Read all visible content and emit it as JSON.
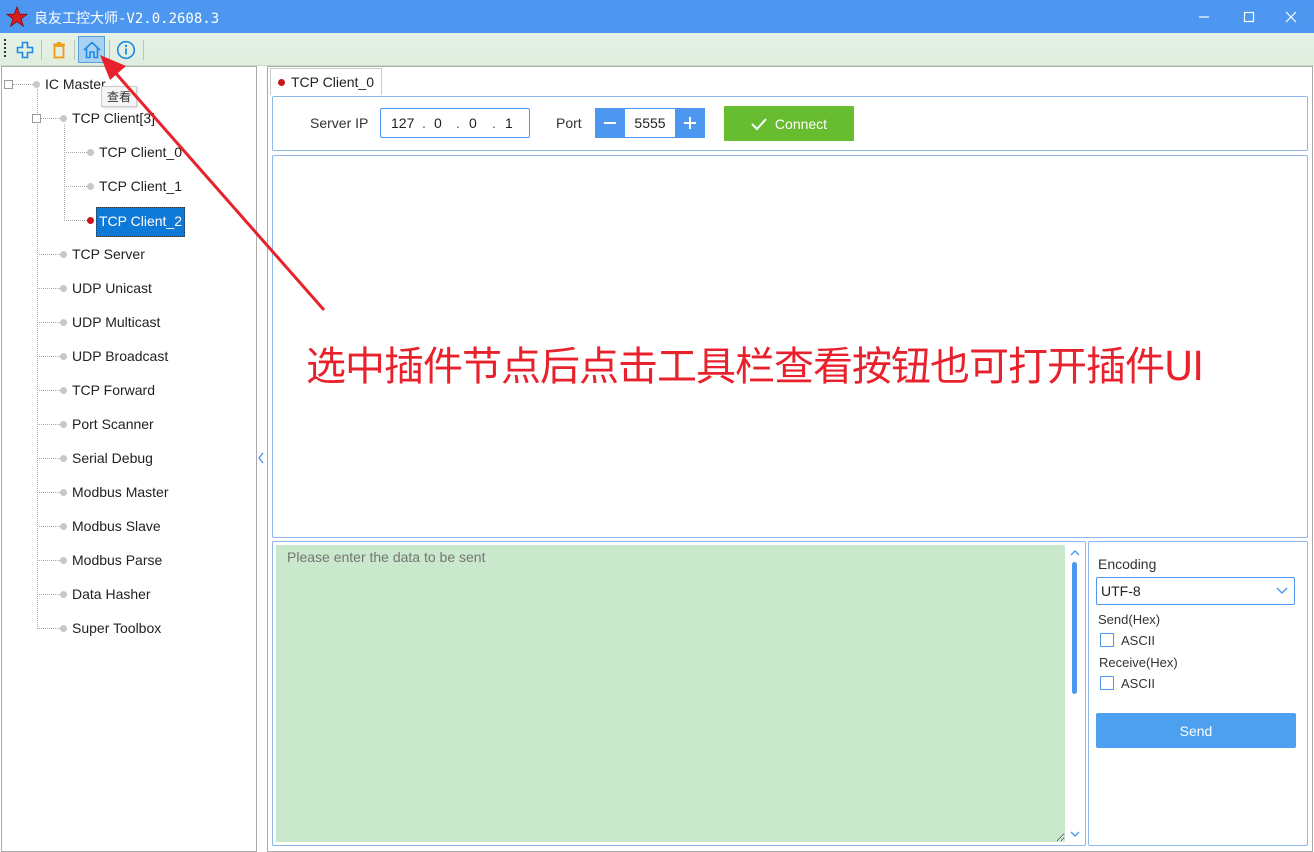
{
  "window": {
    "title": "良友工控大师-V2.0.2608.3",
    "brand_color": "#4d97f0"
  },
  "toolbar": {
    "tooltip": "查看",
    "icons": [
      "add-icon",
      "delete-icon",
      "home-icon",
      "info-icon"
    ]
  },
  "tree": {
    "root": "IC Master",
    "group": "TCP Client[3]",
    "children": [
      "TCP Client_0",
      "TCP Client_1",
      "TCP Client_2"
    ],
    "selected": "TCP Client_2",
    "items": [
      "TCP Server",
      "UDP Unicast",
      "UDP Multicast",
      "UDP Broadcast",
      "TCP Forward",
      "Port Scanner",
      "Serial Debug",
      "Modbus Master",
      "Modbus Slave",
      "Modbus Parse",
      "Data Hasher",
      "Super Toolbox"
    ]
  },
  "tab": {
    "label": "TCP Client_0"
  },
  "connection": {
    "server_ip_label": "Server IP",
    "ip": [
      "127",
      "0",
      "0",
      "1"
    ],
    "port_label": "Port",
    "port": "5555",
    "connect_label": "Connect"
  },
  "send": {
    "placeholder": "Please enter the data to be sent",
    "area_color": "#c9e8cc"
  },
  "options": {
    "encoding_label": "Encoding",
    "encoding_value": "UTF-8",
    "send_hex_label": "Send(Hex)",
    "send_ascii_label": "ASCII",
    "receive_hex_label": "Receive(Hex)",
    "receive_ascii_label": "ASCII",
    "send_button": "Send"
  },
  "annotation": {
    "text": "选中插件节点后点击工具栏查看按钮也可打开插件UI",
    "color": "#e8222c"
  }
}
